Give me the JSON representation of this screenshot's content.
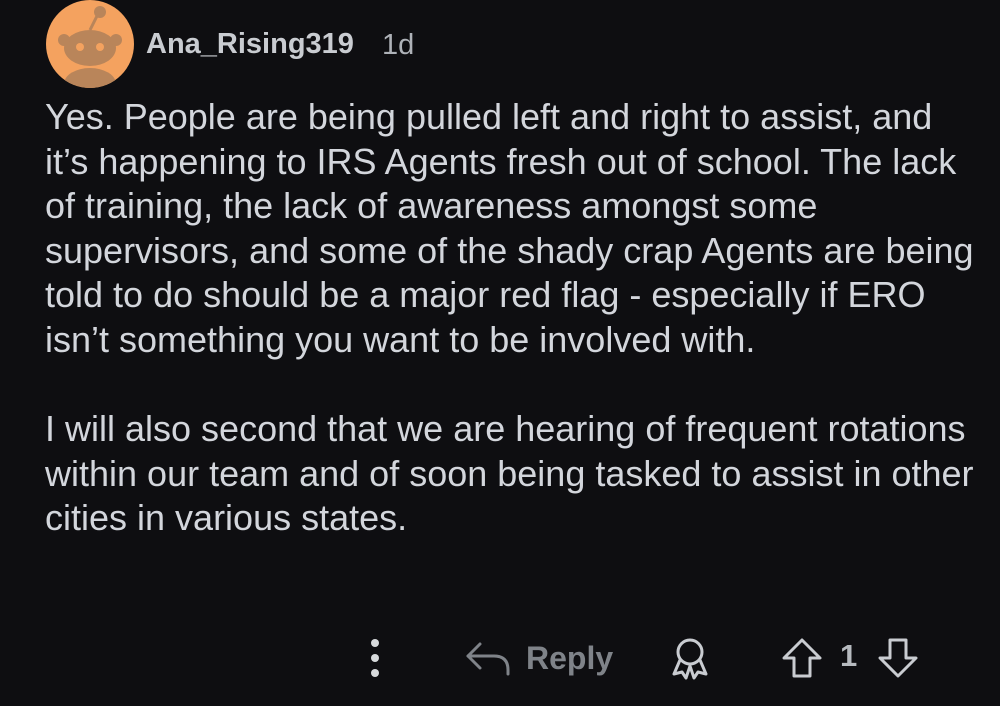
{
  "comment": {
    "author": "Ana_Rising319",
    "age": "1d",
    "paragraphs": [
      "Yes. People are being pulled left and right to assist, and it’s happening to IRS Agents fresh out of school. The lack of training, the lack of awareness amongst some supervisors, and some of the shady crap Agents are being told to do should be a major red flag - especially if ERO isn’t something you want to be involved with.",
      "I will also second that we are hearing of frequent rotations within our team and of soon being tasked to assist in other cities in various states."
    ]
  },
  "actions": {
    "more_icon": "vertical-ellipsis-icon",
    "reply_icon": "reply-arrow-icon",
    "reply_label": "Reply",
    "award_icon": "award-icon",
    "upvote_icon": "up-arrow-icon",
    "score": "1",
    "downvote_icon": "down-arrow-icon"
  },
  "colors": {
    "background": "#0e0e11",
    "text": "#d3d6dc",
    "avatar_bg": "#f4a25f",
    "muted": "#7f8389"
  }
}
